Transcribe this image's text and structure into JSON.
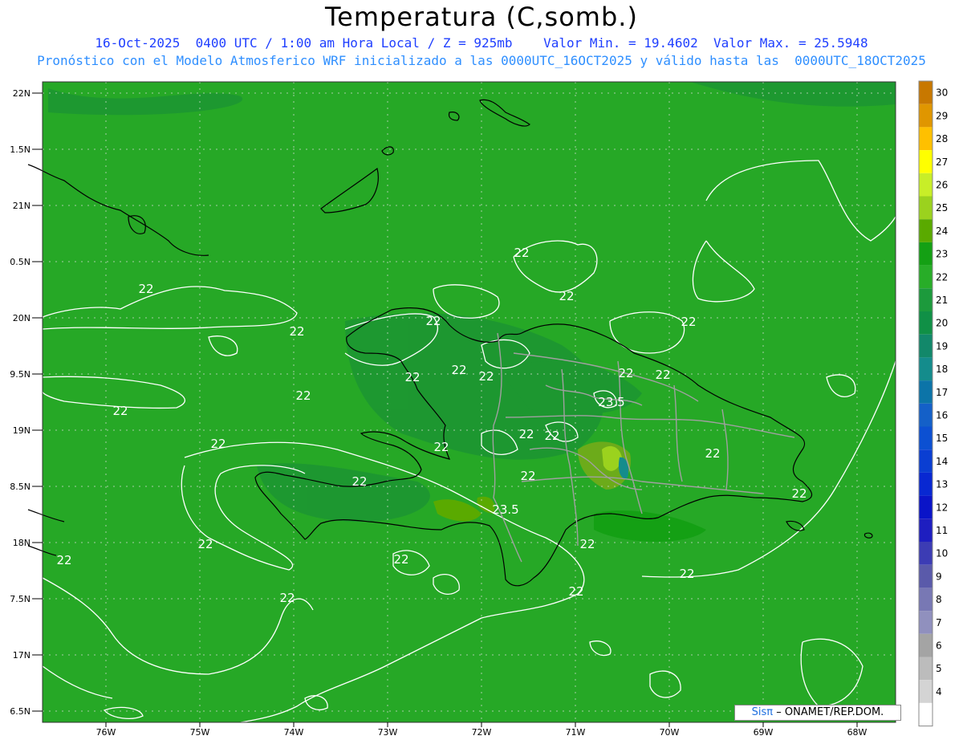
{
  "header": {
    "title": "Temperatura (C,somb.)",
    "line1": "16-Oct-2025  0400 UTC / 1:00 am Hora Local / Z = 925mb    Valor Min. = 19.4602  Valor Max. = 25.5948",
    "line2": "Pronóstico con el Modelo Atmosferico WRF inicializado a las 0000UTC_16OCT2025 y válido hasta las  0000UTC_18OCT2025"
  },
  "map": {
    "variable": "Temperatura",
    "level": "925mb",
    "lat_labels": [
      "22N",
      "1.5N",
      "21N",
      "0.5N",
      "20N",
      "9.5N",
      "19N",
      "8.5N",
      "18N",
      "7.5N",
      "17N",
      "6.5N"
    ],
    "lon_labels": [
      "76W",
      "75W",
      "74W",
      "73W",
      "72W",
      "71W",
      "70W",
      "69W",
      "68W"
    ],
    "contour_labels": [
      {
        "text": "22"
      },
      {
        "text": "22"
      },
      {
        "text": "22"
      },
      {
        "text": "22"
      },
      {
        "text": "22"
      },
      {
        "text": "22"
      },
      {
        "text": "22"
      },
      {
        "text": "22"
      },
      {
        "text": "22"
      },
      {
        "text": "22"
      },
      {
        "text": "22"
      },
      {
        "text": "22"
      },
      {
        "text": "22"
      },
      {
        "text": "22"
      },
      {
        "text": "22"
      },
      {
        "text": "22"
      },
      {
        "text": "22"
      },
      {
        "text": "22"
      },
      {
        "text": "22"
      },
      {
        "text": "22"
      },
      {
        "text": "22"
      },
      {
        "text": "22"
      },
      {
        "text": "22"
      },
      {
        "text": "22"
      },
      {
        "text": "22"
      },
      {
        "text": "22"
      },
      {
        "text": "22"
      },
      {
        "text": "22"
      },
      {
        "text": "23.5"
      },
      {
        "text": "23.5"
      }
    ],
    "colors": {
      "background_field": "#26a826",
      "dark_field": "#1d9632",
      "warm_field": "#6cab1a",
      "contour": "#ffffff",
      "coast": "#000000",
      "borders": "#a0a0a0"
    }
  },
  "colorbar": {
    "levels": [
      "30",
      "29",
      "28",
      "27",
      "26",
      "25",
      "24",
      "23",
      "22",
      "21",
      "20",
      "19",
      "18",
      "17",
      "16",
      "15",
      "14",
      "13",
      "12",
      "11",
      "10",
      "9",
      "8",
      "7",
      "6",
      "5",
      "4"
    ],
    "colors": [
      "#c87800",
      "#e09600",
      "#ffc000",
      "#ffff00",
      "#c8ee28",
      "#9bd21e",
      "#5aaa00",
      "#14a014",
      "#28ad28",
      "#1c9a3c",
      "#109046",
      "#12886a",
      "#148c8c",
      "#0c74a8",
      "#1460c8",
      "#0c50d2",
      "#0a3ed2",
      "#0828d2",
      "#0a14c8",
      "#1e1ec0",
      "#3c3cb4",
      "#5a5aaa",
      "#7878b4",
      "#9090be",
      "#a4a4a4",
      "#bcbcbc",
      "#d4d4d4",
      "#ffffff"
    ]
  },
  "credit": {
    "brand": "Sisπ",
    "text": "– ONAMET/REP.DOM."
  }
}
